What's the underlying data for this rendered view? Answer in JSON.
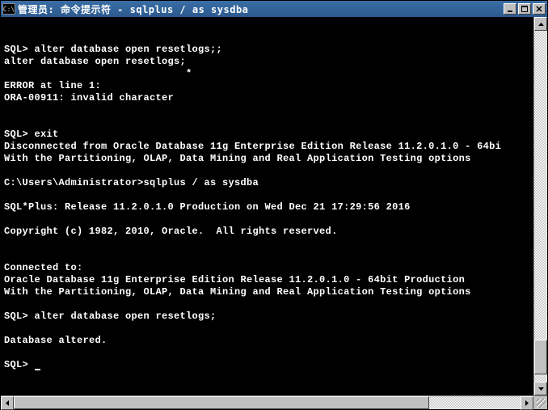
{
  "window": {
    "icon_label": "C:\\",
    "title": "管理员: 命令提示符 - sqlplus  / as sysdba"
  },
  "terminal": {
    "lines": [
      "",
      "",
      "SQL> alter database open resetlogs;;",
      "alter database open resetlogs;",
      "                              *",
      "ERROR at line 1:",
      "ORA-00911: invalid character",
      "",
      "",
      "SQL> exit",
      "Disconnected from Oracle Database 11g Enterprise Edition Release 11.2.0.1.0 - 64bi",
      "With the Partitioning, OLAP, Data Mining and Real Application Testing options",
      "",
      "C:\\Users\\Administrator>sqlplus / as sysdba",
      "",
      "SQL*Plus: Release 11.2.0.1.0 Production on Wed Dec 21 17:29:56 2016",
      "",
      "Copyright (c) 1982, 2010, Oracle.  All rights reserved.",
      "",
      "",
      "Connected to:",
      "Oracle Database 11g Enterprise Edition Release 11.2.0.1.0 - 64bit Production",
      "With the Partitioning, OLAP, Data Mining and Real Application Testing options",
      "",
      "SQL> alter database open resetlogs;",
      "",
      "Database altered.",
      "",
      "SQL> "
    ]
  },
  "scrollbars": {
    "v_thumb_top_pct": 88,
    "v_thumb_height_pct": 10,
    "h_thumb_left_pct": 0,
    "h_thumb_width_pct": 82
  }
}
